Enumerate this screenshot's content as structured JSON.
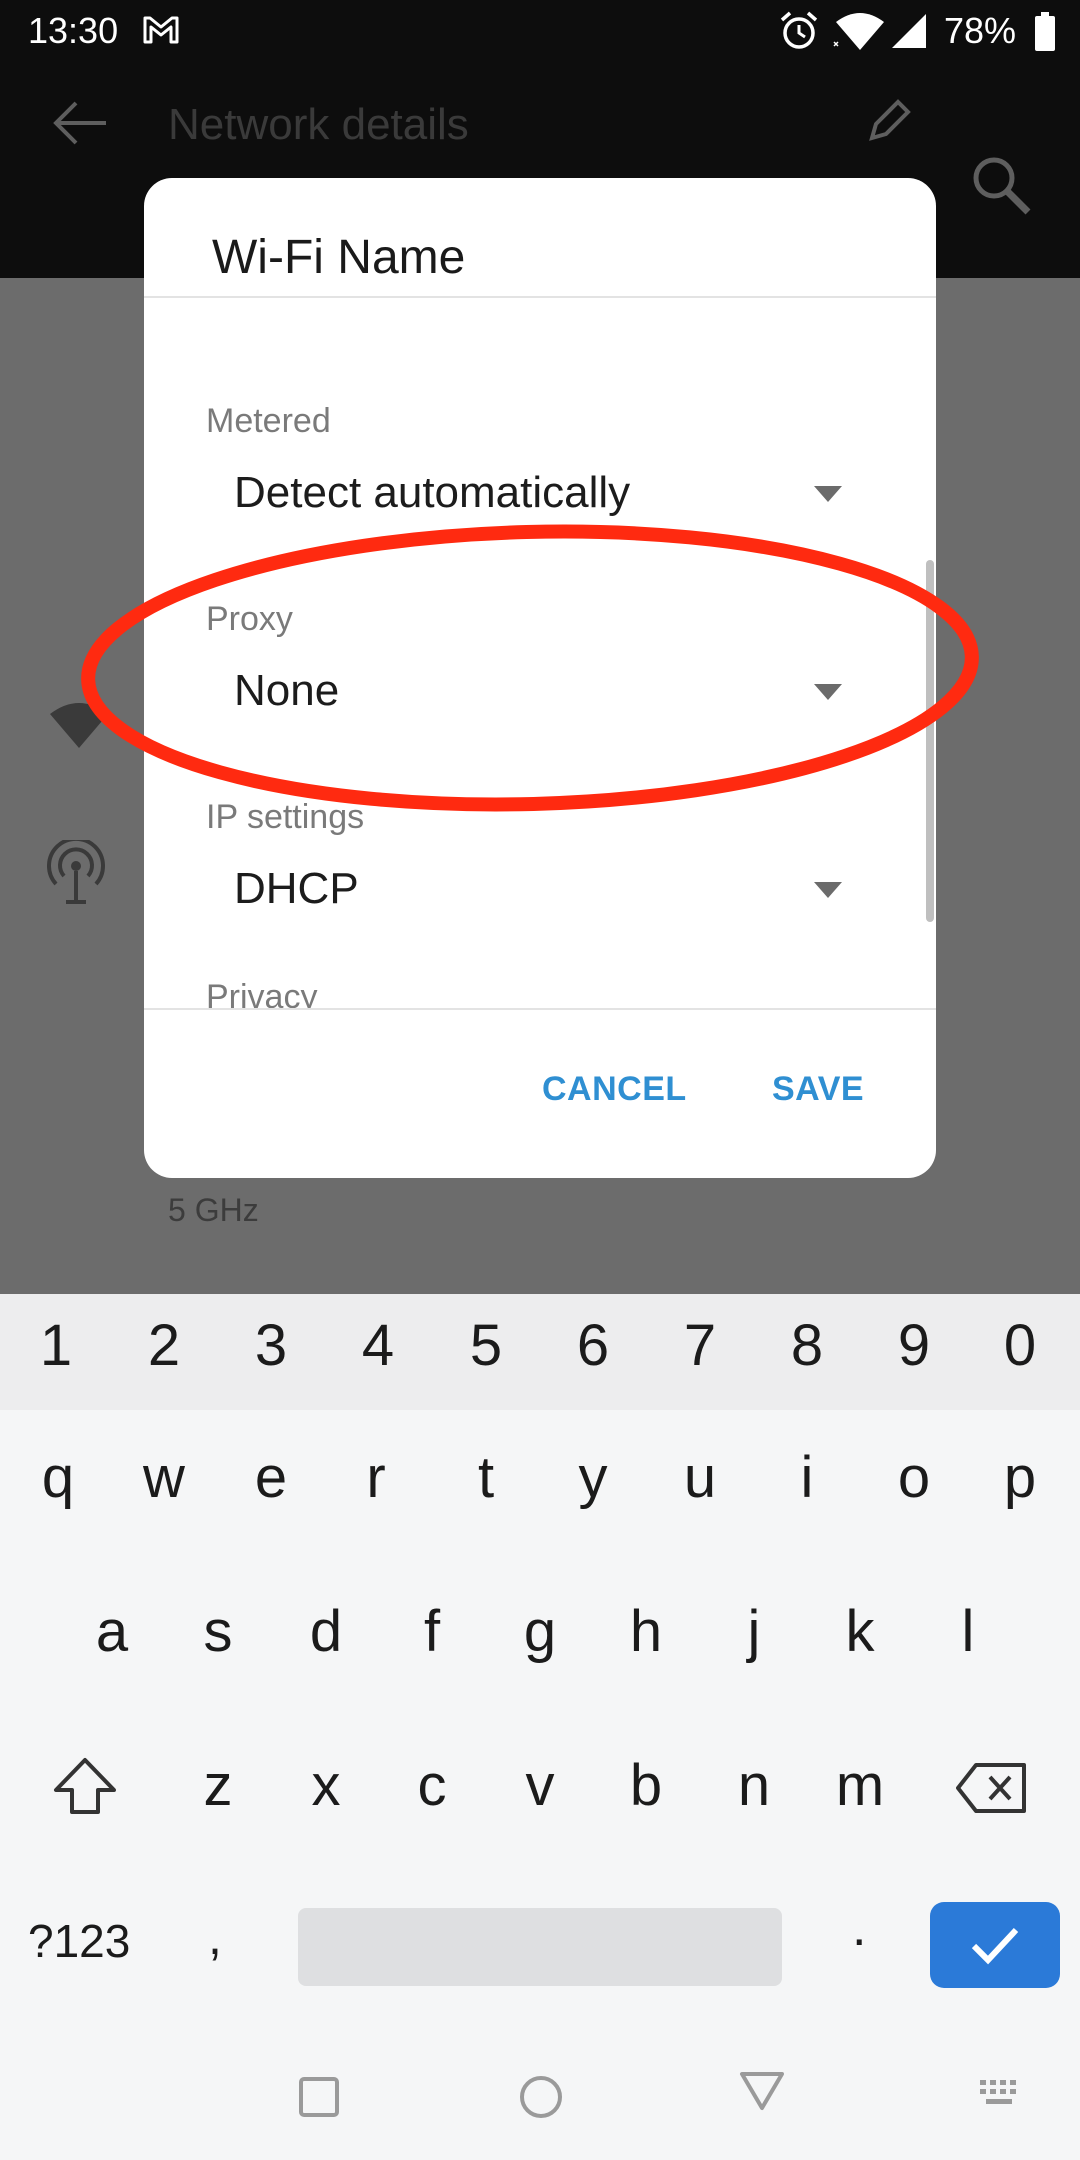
{
  "status_bar": {
    "time": "13:30",
    "battery": "78%",
    "icons": [
      "gmail-icon",
      "alarm-icon",
      "wifi-icon",
      "signal-icon",
      "battery-icon"
    ]
  },
  "app_bar": {
    "title": "Network details",
    "icons": [
      "back-arrow-icon",
      "edit-icon",
      "search-icon"
    ]
  },
  "background": {
    "frequency_value": "5 GHz"
  },
  "dialog": {
    "title": "Wi-Fi Name",
    "fields": [
      {
        "label": "Metered",
        "value": "Detect automatically"
      },
      {
        "label": "Proxy",
        "value": "None"
      },
      {
        "label": "IP settings",
        "value": "DHCP"
      },
      {
        "label": "Privacy"
      }
    ],
    "cancel_label": "CANCEL",
    "save_label": "SAVE"
  },
  "keyboard": {
    "number_row": [
      "1",
      "2",
      "3",
      "4",
      "5",
      "6",
      "7",
      "8",
      "9",
      "0"
    ],
    "row1": [
      "q",
      "w",
      "e",
      "r",
      "t",
      "y",
      "u",
      "i",
      "o",
      "p"
    ],
    "row2": [
      "a",
      "s",
      "d",
      "f",
      "g",
      "h",
      "j",
      "k",
      "l"
    ],
    "row3": [
      "z",
      "x",
      "c",
      "v",
      "b",
      "n",
      "m"
    ],
    "symbols_label": "?123",
    "comma": ",",
    "period": ".",
    "enter_color": "#2b7ad8"
  },
  "highlight_color": "#ff2a10",
  "accent_color": "#2f8fd2"
}
